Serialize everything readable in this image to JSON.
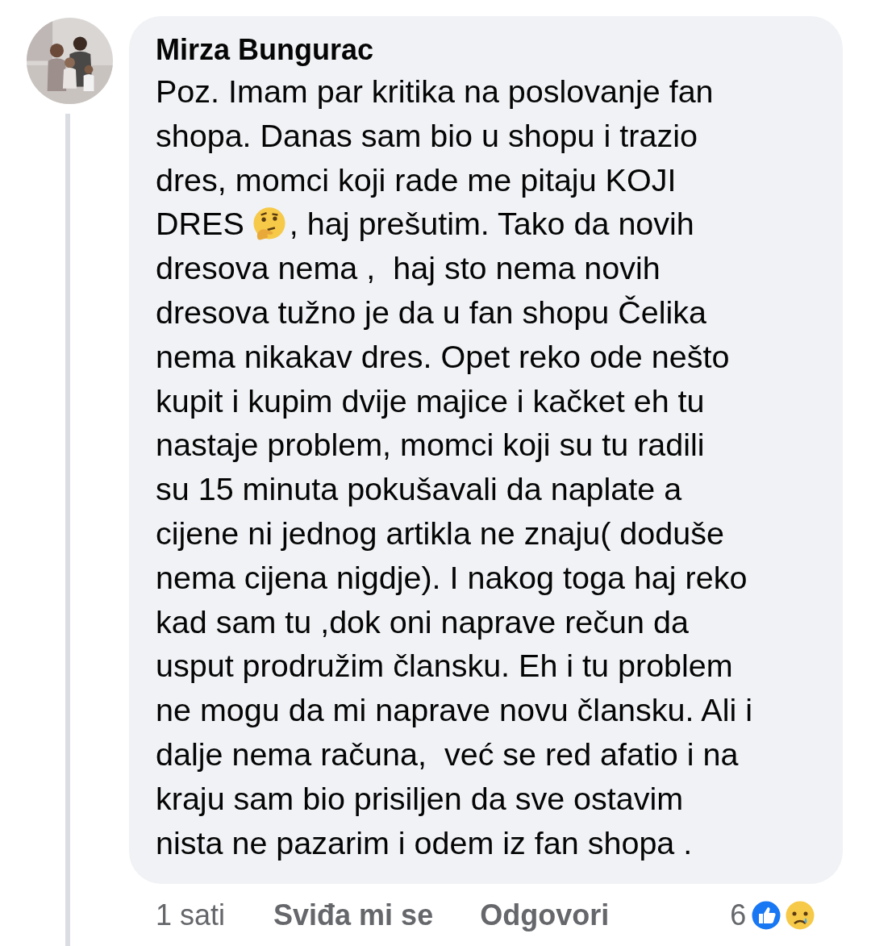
{
  "comment": {
    "author": "Mirza Bungurac",
    "lines": [
      {
        "parts": [
          {
            "kind": "text",
            "text": "Poz. Imam par kritika na poslovanje fan"
          }
        ]
      },
      {
        "parts": [
          {
            "kind": "text",
            "text": "shopa. Danas sam bio u shopu i trazio"
          }
        ]
      },
      {
        "parts": [
          {
            "kind": "text",
            "text": "dres, momci koji rade me pitaju KOJI"
          }
        ]
      },
      {
        "parts": [
          {
            "kind": "text",
            "text": "DRES"
          },
          {
            "kind": "emoji"
          },
          {
            "kind": "text",
            "text": ", haj prešutim. Tako da novih"
          }
        ]
      },
      {
        "parts": [
          {
            "kind": "text",
            "text": "dresova nema ,  haj sto nema novih"
          }
        ]
      },
      {
        "parts": [
          {
            "kind": "text",
            "text": "dresova tužno je da u fan shopu Čelika"
          }
        ]
      },
      {
        "parts": [
          {
            "kind": "text",
            "text": "nema nikakav dres. Opet reko ode nešto"
          }
        ]
      },
      {
        "parts": [
          {
            "kind": "text",
            "text": "kupit i kupim dvije majice i kačket eh tu"
          }
        ]
      },
      {
        "parts": [
          {
            "kind": "text",
            "text": "nastaje problem, momci koji su tu radili"
          }
        ]
      },
      {
        "parts": [
          {
            "kind": "text",
            "text": "su 15 minuta pokušavali da naplate a"
          }
        ]
      },
      {
        "parts": [
          {
            "kind": "text",
            "text": "cijene ni jednog artikla ne znaju( doduše"
          }
        ]
      },
      {
        "parts": [
          {
            "kind": "text",
            "text": "nema cijena nigdje). I nakog toga haj reko"
          }
        ]
      },
      {
        "parts": [
          {
            "kind": "text",
            "text": "kad sam tu ,dok oni naprave rečun da"
          }
        ]
      },
      {
        "parts": [
          {
            "kind": "text",
            "text": "usput prodružim člansku. Eh i tu problem"
          }
        ]
      },
      {
        "parts": [
          {
            "kind": "text",
            "text": "ne mogu da mi naprave novu člansku. Ali i"
          }
        ]
      },
      {
        "parts": [
          {
            "kind": "text",
            "text": "dalje nema računa,  već se red afatio i na"
          }
        ]
      },
      {
        "parts": [
          {
            "kind": "text",
            "text": "kraju sam bio prisiljen da sve ostavim"
          }
        ]
      },
      {
        "parts": [
          {
            "kind": "text",
            "text": "nista ne pazarim i odem iz fan shopa ."
          }
        ]
      }
    ],
    "time": "1 sati",
    "like": "Sviđa mi se",
    "reply": "Odgovori",
    "reaction_count": "6"
  }
}
